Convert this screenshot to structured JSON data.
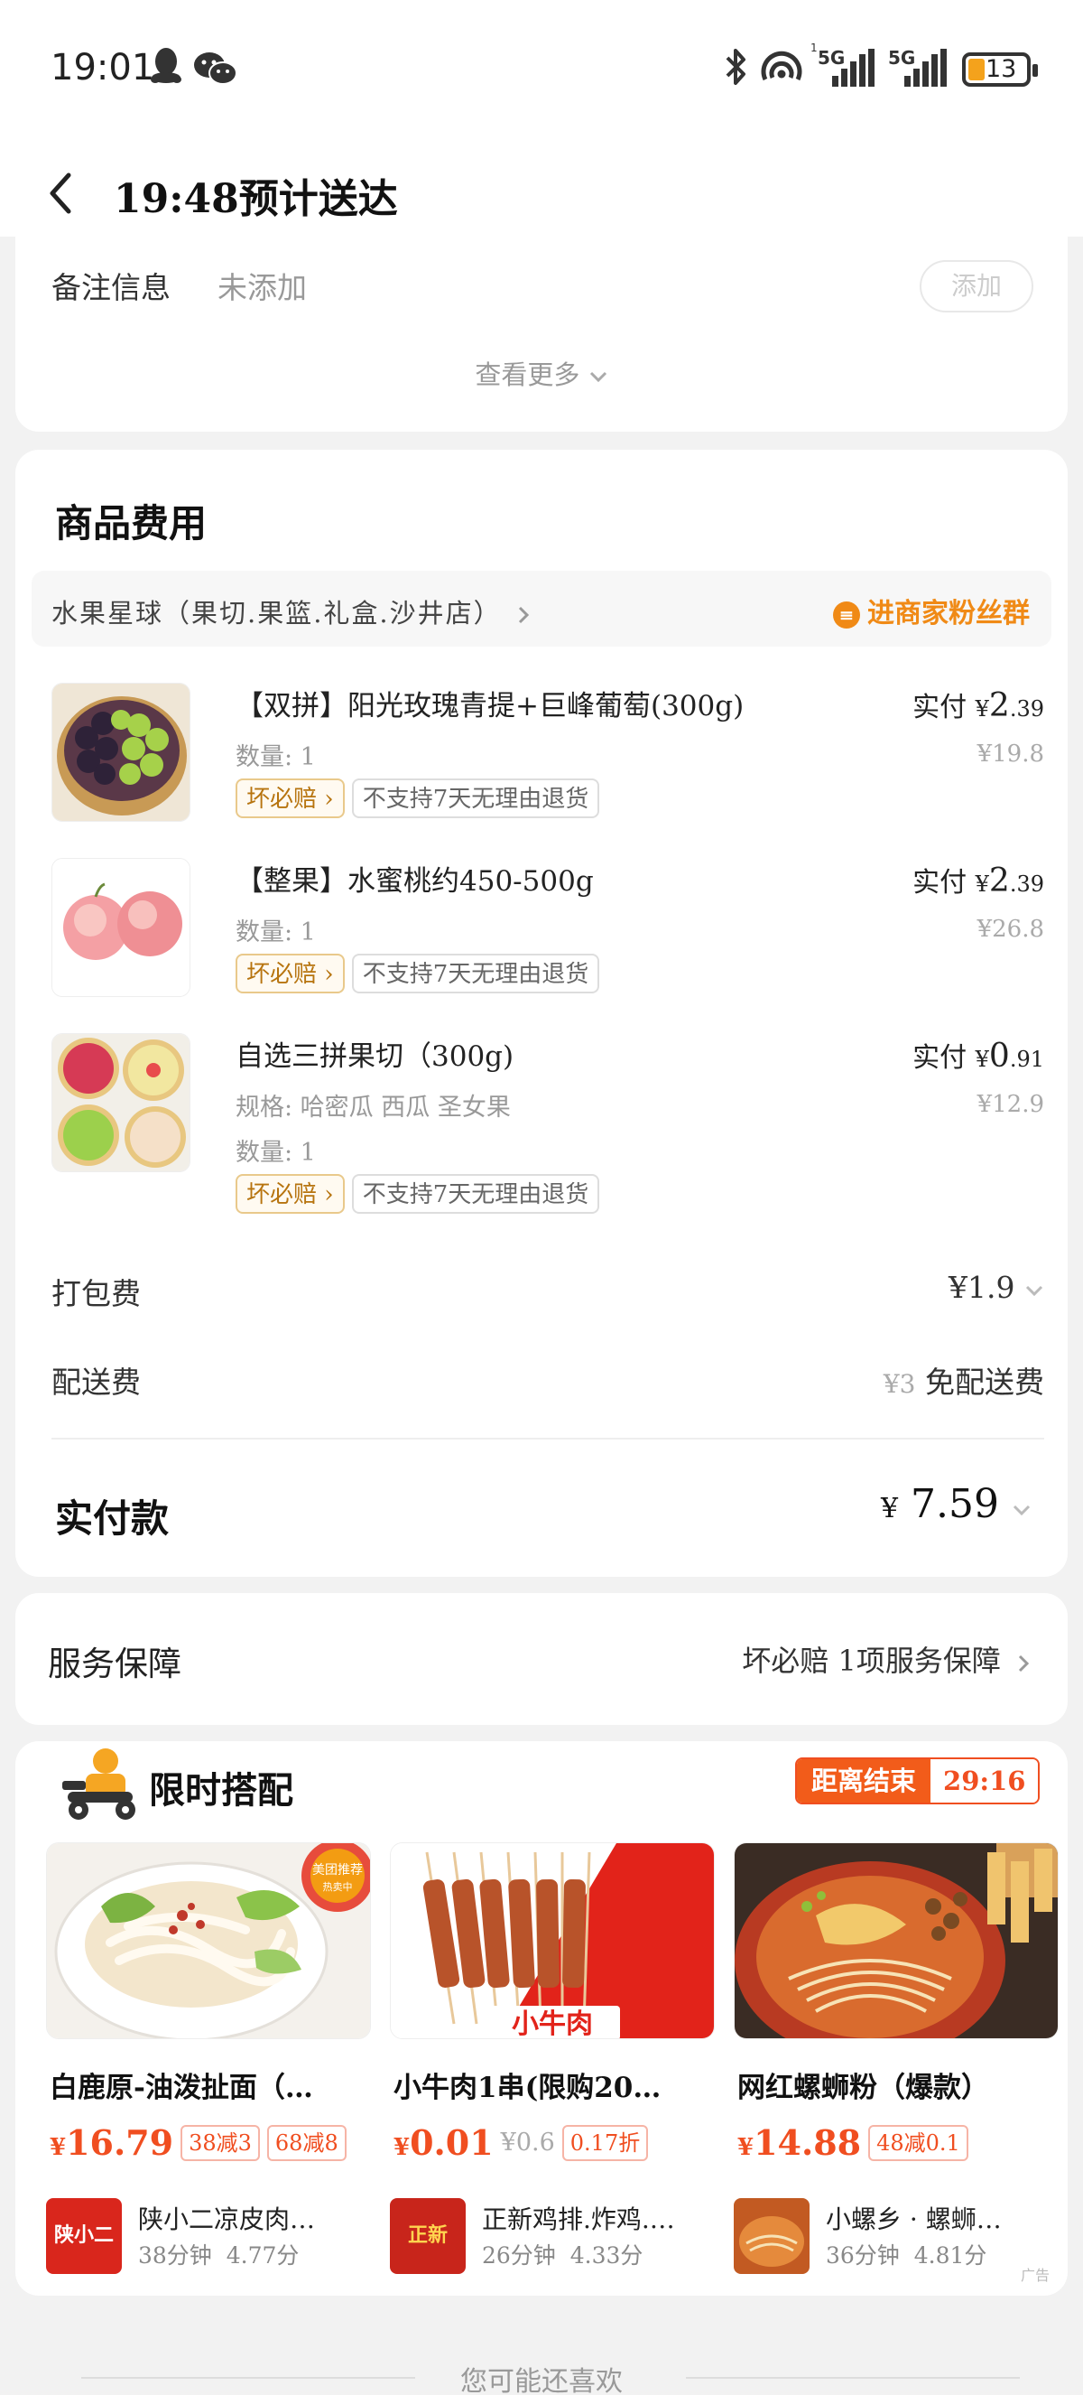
{
  "status_bar": {
    "time": "19:01",
    "signal_1": "5G",
    "signal_2": "5G",
    "battery": "13",
    "icons": [
      "qq-icon",
      "wechat-icon",
      "bluetooth-icon",
      "hotspot-icon",
      "signal-icon",
      "battery-icon"
    ]
  },
  "header": {
    "title": "19:48预计送达"
  },
  "remark": {
    "label": "备注信息",
    "value": "未添加",
    "add_label": "添加",
    "see_more": "查看更多"
  },
  "goods": {
    "title": "商品费用",
    "store_name": "水果星球（果切.果篮.礼盒.沙井店）",
    "fans_group": "进商家粉丝群",
    "items": [
      {
        "name": "【双拼】阳光玫瑰青提+巨峰葡萄(300g)",
        "spec": "",
        "qty": "数量: 1",
        "paid_label": "实付",
        "currency": "¥",
        "paid_int": "2",
        "paid_dec": ".39",
        "orig": "¥19.8",
        "tags": [
          "坏必赔",
          "不支持7天无理由退货"
        ]
      },
      {
        "name": "【整果】水蜜桃约450-500g",
        "spec": "",
        "qty": "数量: 1",
        "paid_label": "实付",
        "currency": "¥",
        "paid_int": "2",
        "paid_dec": ".39",
        "orig": "¥26.8",
        "tags": [
          "坏必赔",
          "不支持7天无理由退货"
        ]
      },
      {
        "name": "自选三拼果切（300g)",
        "spec": "规格: 哈密瓜 西瓜 圣女果",
        "qty": "数量: 1",
        "paid_label": "实付",
        "currency": "¥",
        "paid_int": "0",
        "paid_dec": ".91",
        "orig": "¥12.9",
        "tags": [
          "坏必赔",
          "不支持7天无理由退货"
        ]
      }
    ],
    "packing_fee_label": "打包费",
    "packing_fee": "¥1.9",
    "delivery_fee_label": "配送费",
    "delivery_fee_orig": "¥3",
    "delivery_fee_note": "免配送费",
    "total_label": "实付款",
    "total_currency": "¥",
    "total_value": "7.59"
  },
  "service": {
    "label": "服务保障",
    "value": "坏必赔 1项服务保障"
  },
  "flash": {
    "title": "限时搭配",
    "timer_label": "距离结束",
    "timer_value": "29:16",
    "ad_mark": "广告",
    "products": [
      {
        "name": "白鹿原-油泼扯面（…",
        "currency": "¥",
        "price": "16.79",
        "old_price": "",
        "tags": [
          "38减3",
          "68减8"
        ],
        "shop": "陕小二凉皮肉…",
        "shop_logo_text": "陕小二",
        "time": "38分钟",
        "rating": "4.77分"
      },
      {
        "name": "小牛肉1串(限购20…",
        "currency": "¥",
        "price": "0.01",
        "old_price": "¥0.6",
        "tags": [
          "0.17折"
        ],
        "shop": "正新鸡排.炸鸡.…",
        "shop_logo_text": "正新",
        "time": "26分钟",
        "rating": "4.33分"
      },
      {
        "name": "网红螺蛳粉（爆款）",
        "currency": "¥",
        "price": "14.88",
        "old_price": "",
        "tags": [
          "48减0.1"
        ],
        "shop": "小螺乡 · 螺蛳…",
        "shop_logo_text": "",
        "time": "36分钟",
        "rating": "4.81分"
      }
    ],
    "banner_texts": [
      "美团推荐",
      "热卖中",
      "小牛肉"
    ]
  },
  "footer": {
    "guess_you_like": "您可能还喜欢"
  },
  "colors": {
    "accent_orange": "#f08a16",
    "price_red": "#f04e20",
    "page_bg": "#f2f2f2"
  }
}
